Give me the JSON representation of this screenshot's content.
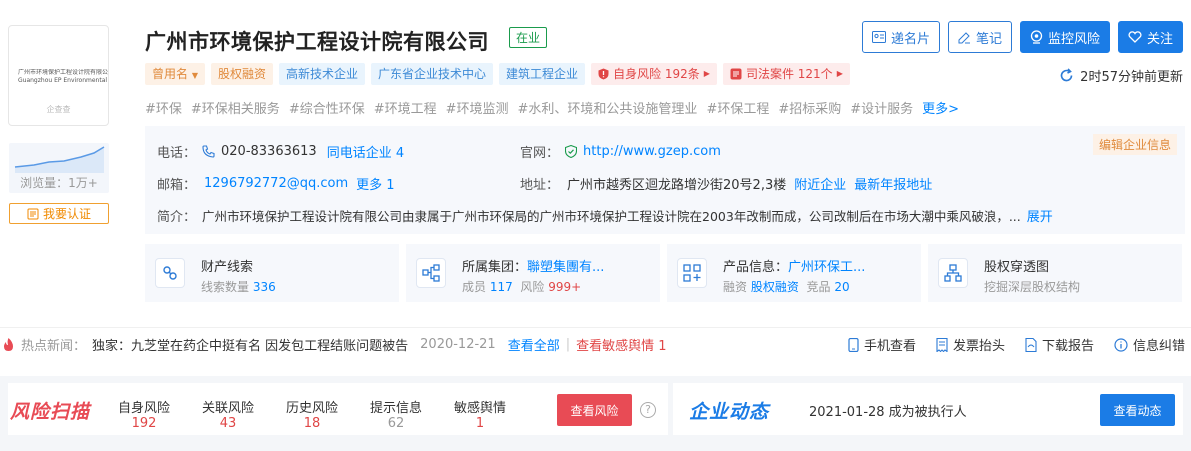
{
  "company": {
    "name": "广州市环境保护工程设计院有限公司",
    "status": "在业",
    "logo_text_cn": "广州市环境保护工程设计院有限公司",
    "logo_text_en": "Guangzhou EP Environmental Engineering LTD.",
    "logo_watermark": "企查查"
  },
  "sidebar": {
    "views_label": "浏览量：1万+",
    "verify_label": "我要认证"
  },
  "tags": [
    {
      "label": "曾用名",
      "style": "orange",
      "dropdown": true
    },
    {
      "label": "股权融资",
      "style": "orange"
    },
    {
      "label": "高新技术企业",
      "style": "blue"
    },
    {
      "label": "广东省企业技术中心",
      "style": "blue"
    },
    {
      "label": "建筑工程企业",
      "style": "blue"
    },
    {
      "label": "自身风险 192条",
      "style": "red"
    },
    {
      "label": "司法案件 121个",
      "style": "red"
    }
  ],
  "keywords": [
    "#环保",
    "#环保相关服务",
    "#综合性环保",
    "#环境工程",
    "#环境监测",
    "#水利、环境和公共设施管理业",
    "#环保工程",
    "#招标采购",
    "#设计服务"
  ],
  "keywords_more": "更多>",
  "actions": {
    "card": "递名片",
    "note": "笔记",
    "monitor": "监控风险",
    "follow": "关注"
  },
  "update_text": "2时57分钟前更新",
  "info": {
    "phone_label": "电话：",
    "phone": "020-83363613",
    "phone_same": "同电话企业 4",
    "website_label": "官网：",
    "website": "http://www.gzep.com",
    "email_label": "邮箱：",
    "email": "1296792772@qq.com",
    "email_more": "更多 1",
    "address_label": "地址：",
    "address": "广州市越秀区迴龙路增沙街20号2,3楼",
    "address_nearby": "附近企业",
    "address_report": "最新年报地址",
    "intro_label": "简介：",
    "intro": "广州市环境保护工程设计院有限公司由隶属于广州市环保局的广州市环境保护工程设计院在2003年改制而成，公司改制后在市场大潮中乘风破浪，...",
    "intro_expand": "展开",
    "edit": "编辑企业信息"
  },
  "cards": [
    {
      "title": "财产线索",
      "sub_label": "线索数量 ",
      "sub_value": "336",
      "icon": "clue-icon"
    },
    {
      "title": "所属集团：",
      "title_link": "聯塑集團有...",
      "sub_label": "成员 ",
      "sub_value": "117",
      "sub_label2": "风险 ",
      "sub_value2": "999+",
      "icon": "group-icon"
    },
    {
      "title": "产品信息：",
      "title_link": "广州环保工...",
      "sub_label": "融资 ",
      "sub_value": "股权融资",
      "sub_label2": "竞品 ",
      "sub_value2": "20",
      "icon": "product-icon"
    },
    {
      "title_link": "股权穿透图",
      "sub_label": "挖掘深层股权结构",
      "icon": "equity-icon"
    }
  ],
  "news": {
    "label": "热点新闻：",
    "headline": "独家：九芝堂在药企中挺有名 因发包工程结账问题被告",
    "date": "2020-12-21",
    "view_all": "查看全部",
    "sep": "|",
    "view_sensitive": "查看敏感舆情 1"
  },
  "tools": [
    "手机查看",
    "发票抬头",
    "下载报告",
    "信息纠错"
  ],
  "risk": {
    "logo": "风险扫描",
    "cols": [
      {
        "label": "自身风险",
        "value": "192"
      },
      {
        "label": "关联风险",
        "value": "43"
      },
      {
        "label": "历史风险",
        "value": "18"
      },
      {
        "label": "提示信息",
        "value": "62"
      },
      {
        "label": "敏感舆情",
        "value": "1"
      }
    ],
    "button": "查看风险"
  },
  "dynamics": {
    "logo": "企业动态",
    "text": "2021-01-28 成为被执行人",
    "button": "查看动态"
  }
}
